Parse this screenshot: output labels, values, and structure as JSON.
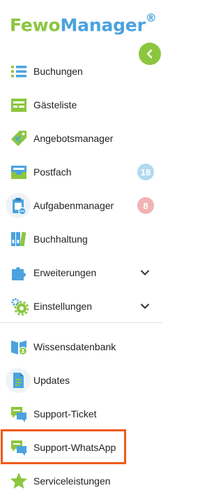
{
  "logo": {
    "part1": "Fewo",
    "part2": "Manager",
    "mark": "®"
  },
  "collapse_button": {
    "icon": "chevron-left-icon"
  },
  "nav": [
    {
      "id": "buchungen",
      "label": "Buchungen",
      "icon": "list-icon"
    },
    {
      "id": "gaesteliste",
      "label": "Gästeliste",
      "icon": "guest-list-icon"
    },
    {
      "id": "angebotsmanager",
      "label": "Angebotsmanager",
      "icon": "price-tag-icon"
    },
    {
      "id": "postfach",
      "label": "Postfach",
      "icon": "inbox-icon",
      "badge": "18"
    },
    {
      "id": "aufgabenmanager",
      "label": "Aufgabenmanager",
      "icon": "clipboard-icon",
      "badge": "8"
    },
    {
      "id": "buchhaltung",
      "label": "Buchhaltung",
      "icon": "binders-icon"
    },
    {
      "id": "erweiterungen",
      "label": "Erweiterungen",
      "icon": "puzzle-icon",
      "expandable": true
    },
    {
      "id": "einstellungen",
      "label": "Einstellungen",
      "icon": "gears-icon",
      "expandable": true
    },
    {
      "id": "wissensdatenbank",
      "label": "Wissensdatenbank",
      "icon": "knowledge-book-icon"
    },
    {
      "id": "updates",
      "label": "Updates",
      "icon": "document-icon"
    },
    {
      "id": "support-ticket",
      "label": "Support-Ticket",
      "icon": "chat-bubbles-icon"
    },
    {
      "id": "support-whatsapp",
      "label": "Support-WhatsApp",
      "icon": "chat-bubbles-icon",
      "highlighted": true
    },
    {
      "id": "serviceleistungen",
      "label": "Serviceleistungen",
      "icon": "star-icon"
    }
  ],
  "colors": {
    "green": "#8cc63f",
    "blue": "#4aa3df",
    "highlight": "#f05a1a"
  }
}
